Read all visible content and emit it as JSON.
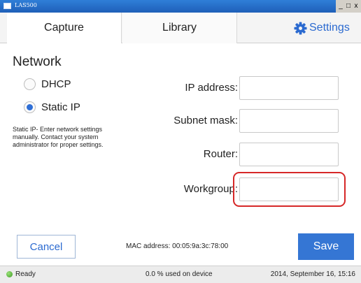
{
  "window": {
    "title": "LAS500",
    "minimize": "_",
    "maximize": "□",
    "close": "x"
  },
  "tabs": {
    "capture": "Capture",
    "library": "Library",
    "settings": "Settings"
  },
  "network": {
    "title": "Network",
    "dhcp_label": "DHCP",
    "static_label": "Static IP",
    "selected": "Static IP",
    "help_text": "Static IP- Enter network settings manually. Contact your system administrator for proper settings."
  },
  "fields": {
    "ip_label": "IP address:",
    "subnet_label": "Subnet mask:",
    "router_label": "Router:",
    "workgroup_label": "Workgroup:",
    "ip_value": "",
    "subnet_value": "",
    "router_value": "",
    "workgroup_value": ""
  },
  "footer": {
    "cancel_label": "Cancel",
    "mac_text": "MAC address: 00:05:9a:3c:78:00",
    "save_label": "Save"
  },
  "status": {
    "ready": "Ready",
    "usage": "0.0 % used on device",
    "datetime": "2014, September 16, 15:16"
  },
  "colors": {
    "accent": "#3576d4",
    "highlight": "#d62828",
    "ready": "#3c9a21"
  }
}
